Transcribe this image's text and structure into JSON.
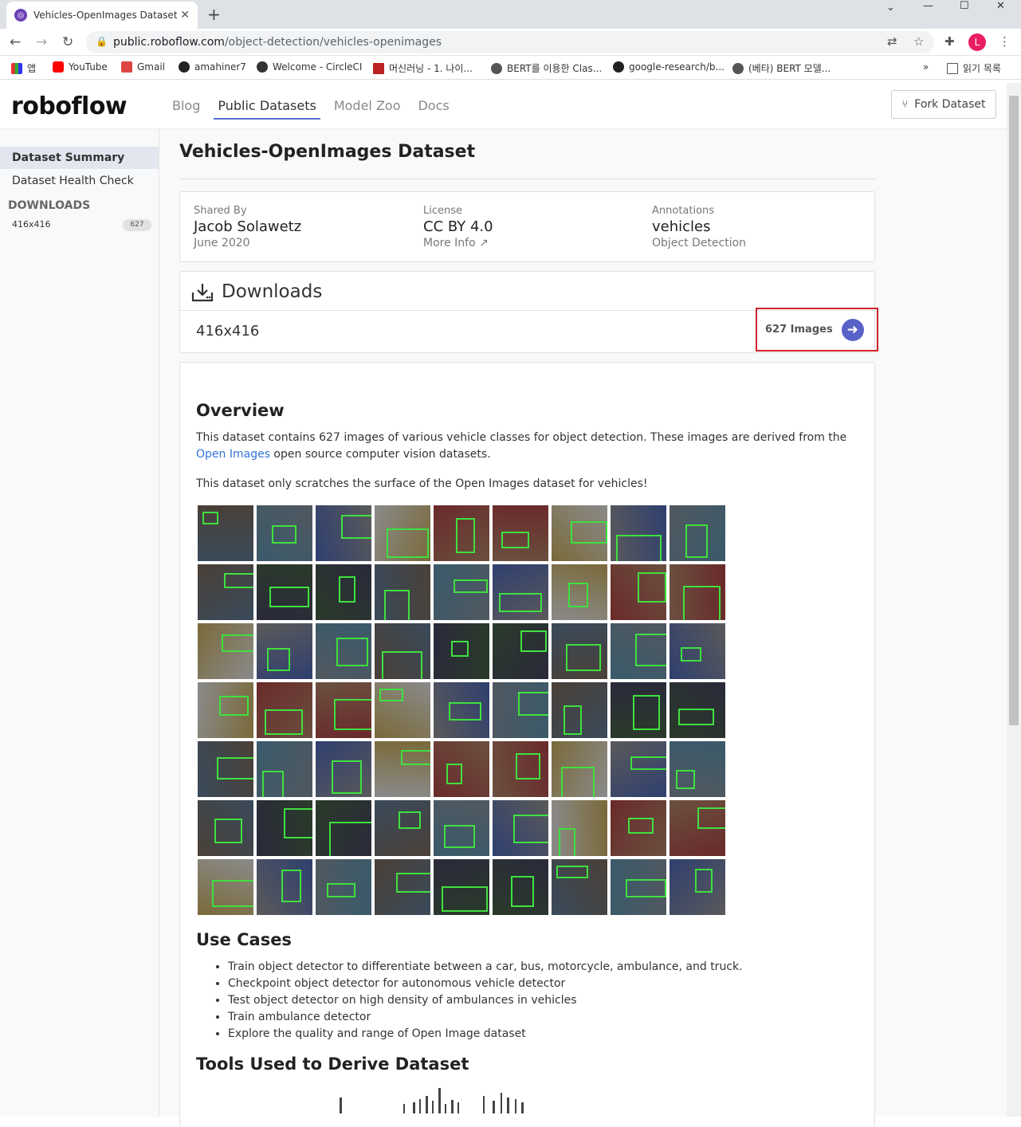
{
  "browser": {
    "tab_title": "Vehicles-OpenImages Dataset",
    "url_domain": "public.roboflow.com",
    "url_path": "/object-detection/vehicles-openimages",
    "profile_initial": "L",
    "bookmarks": [
      "앱",
      "YouTube",
      "Gmail",
      "amahiner7",
      "Welcome - CircleCI",
      "머신러닝 - 1. 나이...",
      "BERT를 이용한 Clas...",
      "google-research/b...",
      "(베타) BERT 모델...",
      "읽기 목록"
    ],
    "more_bookmarks": "»"
  },
  "header": {
    "logo": "roboflow",
    "nav": [
      "Blog",
      "Public Datasets",
      "Model Zoo",
      "Docs"
    ],
    "active_nav": "Public Datasets",
    "fork_label": "Fork Dataset"
  },
  "sidebar": {
    "items": [
      "Dataset Summary",
      "Dataset Health Check"
    ],
    "downloads_heading": "DOWNLOADS",
    "download_item": "416x416",
    "download_count": "627"
  },
  "page": {
    "title": "Vehicles-OpenImages Dataset",
    "shared_by_label": "Shared By",
    "shared_by": "Jacob Solawetz",
    "shared_date": "June 2020",
    "license_label": "License",
    "license": "CC BY 4.0",
    "more_info": "More Info",
    "annotations_label": "Annotations",
    "annotations": "vehicles",
    "annotation_type": "Object Detection"
  },
  "downloads": {
    "title": "Downloads",
    "resolution": "416x416",
    "images_label": "627 Images"
  },
  "overview": {
    "heading": "Overview",
    "p1_before": "This dataset contains 627 images of various vehicle classes for object detection. These images are derived from the ",
    "p1_link": "Open Images",
    "p1_after": " open source computer vision datasets.",
    "p2": "This dataset only scratches the surface of the Open Images dataset for vehicles!"
  },
  "use_cases": {
    "heading": "Use Cases",
    "items": [
      "Train object detector to differentiate between a car, bus, motorcycle, ambulance, and truck.",
      "Checkpoint object detector for autonomous vehicle detector",
      "Test object detector on high density of ambulances in vehicles",
      "Train ambulance detector",
      "Explore the quality and range of Open Image dataset"
    ]
  },
  "tools": {
    "heading": "Tools Used to Derive Dataset"
  },
  "colors": {
    "accent": "#5b6fd6",
    "highlight_border": "#d3242b",
    "bbox": "#3fe03f",
    "link": "#3273dc"
  }
}
